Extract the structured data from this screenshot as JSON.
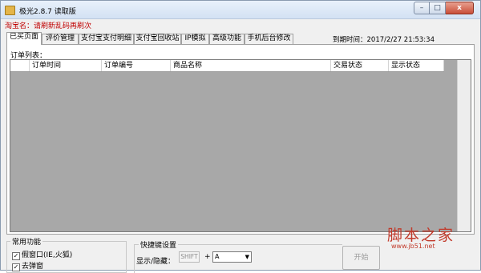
{
  "window": {
    "title": "极光2.8.7 读取版",
    "minimize_glyph": "–",
    "maximize_glyph": "□",
    "close_glyph": "x"
  },
  "shop": {
    "label": "淘宝名：",
    "value": "请刷新乱码再刷次"
  },
  "tabs": [
    {
      "label": "已买页面",
      "active": true
    },
    {
      "label": "评价管理",
      "active": false
    },
    {
      "label": "支付宝支付明细",
      "active": false
    },
    {
      "label": "支付宝回收站",
      "active": false
    },
    {
      "label": "IP模拟",
      "active": false
    },
    {
      "label": "高级功能",
      "active": false
    },
    {
      "label": "手机后台修改",
      "active": false
    }
  ],
  "expire": {
    "label": "到期时间：",
    "value": "2017/2/27 21:53:34"
  },
  "orders": {
    "label": "订单列表：",
    "columns": [
      "",
      "订单时间",
      "订单编号",
      "商品名称",
      "交易状态",
      "显示状态"
    ]
  },
  "common": {
    "title": "常用功能",
    "options": [
      {
        "label": "假窗口(IE,火狐)",
        "checked": true
      },
      {
        "label": "去弹窗",
        "checked": true
      }
    ]
  },
  "hotkey": {
    "title": "快捷键设置",
    "show_hide_label": "显示/隐藏：",
    "modifier": "SHIFT",
    "plus": "+",
    "key": "A"
  },
  "start_button": "开始",
  "watermark": {
    "text": "脚本之家",
    "url": "www.jb51.net"
  },
  "colors": {
    "shop_name": "#c00000",
    "watermark": "#c23a2b",
    "grid_background": "#a8a8a8"
  },
  "icons": {
    "app": "app-icon",
    "dropdown": "chevron-down-icon",
    "check": "checkmark-icon"
  }
}
